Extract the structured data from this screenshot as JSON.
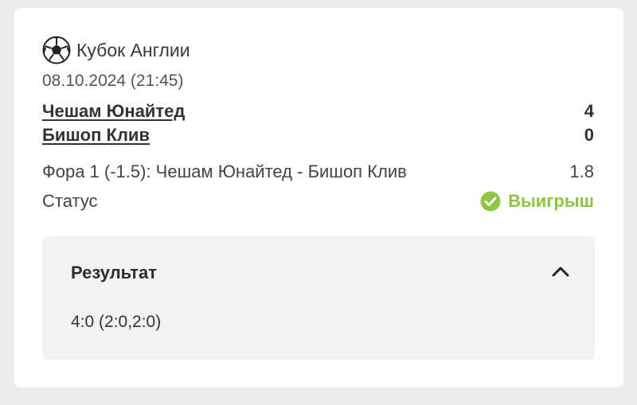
{
  "match": {
    "league": "Кубок Англии",
    "date": "08.10.2024 (21:45)",
    "team1": {
      "name": "Чешам Юнайтед",
      "score": "4"
    },
    "team2": {
      "name": "Бишоп Клив",
      "score": "0"
    }
  },
  "bet": {
    "description": "Фора 1 (-1.5): Чешам Юнайтед - Бишоп Клив",
    "odds": "1.8"
  },
  "status": {
    "label": "Статус",
    "value": "Выигрыш",
    "icon": "check-circle-icon",
    "color": "#8dc63f"
  },
  "result": {
    "title": "Результат",
    "score": "4:0 (2:0,2:0)",
    "expanded": true,
    "toggle_icon": "chevron-up-icon"
  },
  "league_icon": "soccer-ball-icon"
}
